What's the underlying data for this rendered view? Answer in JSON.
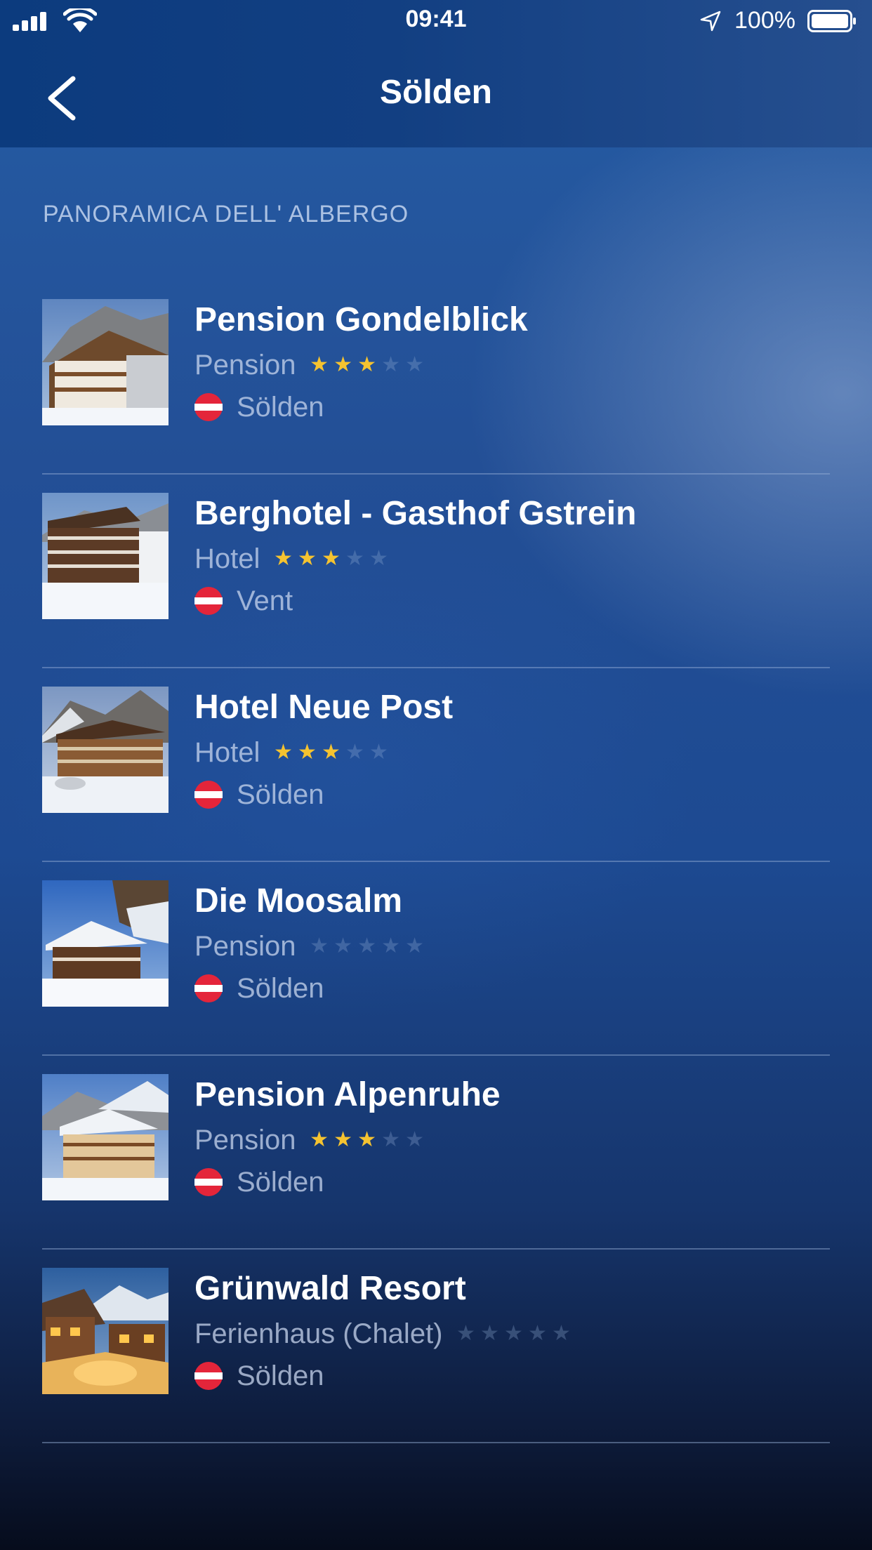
{
  "status_bar": {
    "time": "09:41",
    "battery": "100%"
  },
  "nav": {
    "title": "Sölden",
    "back_icon": "chevron-left-icon"
  },
  "section_header": "PANORAMICA DELL' ALBERGO",
  "hotels": [
    {
      "name": "Pension Gondelblick",
      "type": "Pension",
      "stars": 3,
      "max_stars": 5,
      "location": "Sölden"
    },
    {
      "name": "Berghotel - Gasthof Gstrein",
      "type": "Hotel",
      "stars": 3,
      "max_stars": 5,
      "location": "Vent"
    },
    {
      "name": "Hotel Neue Post",
      "type": "Hotel",
      "stars": 3,
      "max_stars": 5,
      "location": "Sölden"
    },
    {
      "name": "Die Moosalm",
      "type": "Pension",
      "stars": 0,
      "max_stars": 5,
      "location": "Sölden"
    },
    {
      "name": "Pension Alpenruhe",
      "type": "Pension",
      "stars": 3,
      "max_stars": 5,
      "location": "Sölden"
    },
    {
      "name": "Grünwald Resort",
      "type": "Ferienhaus (Chalet)",
      "stars": 0,
      "max_stars": 5,
      "location": "Sölden"
    }
  ],
  "colors": {
    "star_filled": "#f5c330",
    "flag_red": "#e4253a",
    "background": "#1d4a92"
  }
}
